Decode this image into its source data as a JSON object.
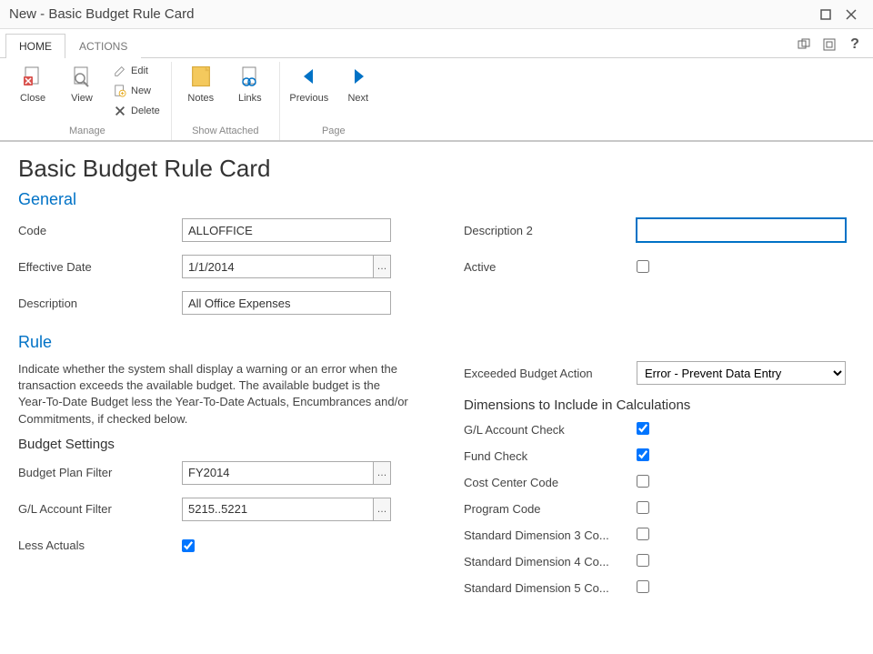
{
  "window": {
    "title": "New - Basic Budget Rule Card"
  },
  "tabs": {
    "home": "HOME",
    "actions": "ACTIONS"
  },
  "ribbon": {
    "close": "Close",
    "view": "View",
    "edit": "Edit",
    "new": "New",
    "delete": "Delete",
    "notes": "Notes",
    "links": "Links",
    "previous": "Previous",
    "next": "Next",
    "g_manage": "Manage",
    "g_show": "Show Attached",
    "g_page": "Page"
  },
  "page": {
    "title": "Basic Budget Rule Card"
  },
  "general": {
    "heading": "General",
    "code_label": "Code",
    "code_value": "ALLOFFICE",
    "effdate_label": "Effective Date",
    "effdate_value": "1/1/2014",
    "desc_label": "Description",
    "desc_value": "All Office Expenses",
    "desc2_label": "Description 2",
    "desc2_value": "",
    "active_label": "Active",
    "active_checked": false
  },
  "rule": {
    "heading": "Rule",
    "desc": "Indicate whether the system shall display a warning or an error when the transaction exceeds the available budget. The available budget is the Year-To-Date Budget less the Year-To-Date Actuals, Encumbrances and/or Commitments, if checked below.",
    "budget_settings_heading": "Budget Settings",
    "budget_plan_label": "Budget Plan Filter",
    "budget_plan_value": "FY2014",
    "gl_filter_label": "G/L Account Filter",
    "gl_filter_value": "5215..5221",
    "less_actuals_label": "Less Actuals",
    "less_actuals_checked": true,
    "exceeded_label": "Exceeded Budget Action",
    "exceeded_value": "Error - Prevent Data Entry",
    "dim_heading": "Dimensions to Include in Calculations",
    "dims": [
      {
        "label": "G/L Account Check",
        "checked": true
      },
      {
        "label": "Fund Check",
        "checked": true
      },
      {
        "label": "Cost Center Code",
        "checked": false
      },
      {
        "label": "Program Code",
        "checked": false
      },
      {
        "label": "Standard Dimension 3 Co...",
        "checked": false
      },
      {
        "label": "Standard Dimension 4 Co...",
        "checked": false
      },
      {
        "label": "Standard Dimension 5 Co...",
        "checked": false
      }
    ]
  }
}
